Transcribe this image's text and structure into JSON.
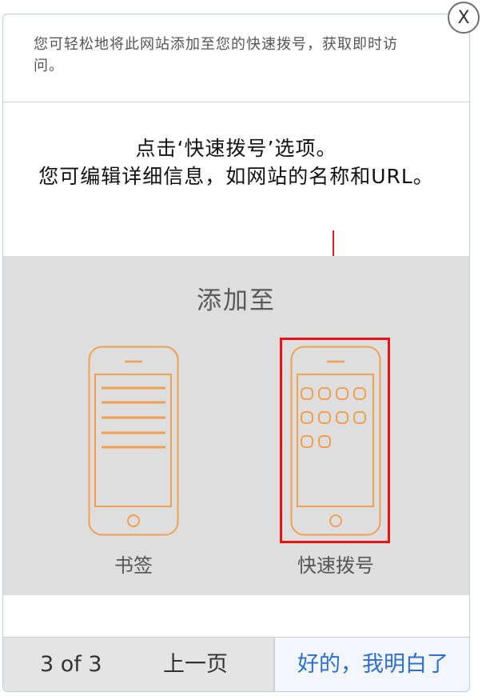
{
  "dialog": {
    "close_label": "X",
    "header_text": "您可轻松地将此网站添加至您的快速拨号，获取即时访问。",
    "instruction_line1": "点击‘快速拨号’选项。",
    "instruction_line2": "您可编辑详细信息，如网站的名称和URL。"
  },
  "illustration": {
    "title": "添加至",
    "left_phone_label": "书签",
    "right_phone_label": "快速拨号",
    "accent_color": "#f0a050",
    "highlight_color": "#ee1111"
  },
  "footer": {
    "page_indicator": "3 of 3",
    "prev_label": "上一页",
    "ok_label": "好的，我明白了"
  }
}
